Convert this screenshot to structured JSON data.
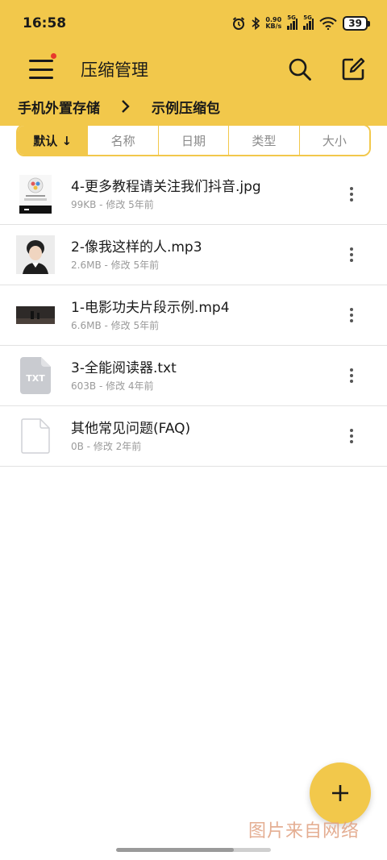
{
  "status_bar": {
    "time": "16:58",
    "net_speed_value": "0.90",
    "net_speed_unit": "KB/s",
    "sim1": "5G",
    "sim2": "5G",
    "battery": "39"
  },
  "app_bar": {
    "title": "压缩管理",
    "menu_icon": "hamburger-menu-icon",
    "search_icon": "search-icon",
    "edit_icon": "edit-icon",
    "notification_dot_color": "#e8382c"
  },
  "breadcrumb": {
    "root": "手机外置存储",
    "current": "示例压缩包"
  },
  "sort_tabs": [
    {
      "label": "默认 ↓",
      "active": true
    },
    {
      "label": "名称",
      "active": false
    },
    {
      "label": "日期",
      "active": false
    },
    {
      "label": "类型",
      "active": false
    },
    {
      "label": "大小",
      "active": false
    }
  ],
  "files": [
    {
      "name": "4-更多教程请关注我们抖音.jpg",
      "meta": "99KB - 修改 5年前",
      "thumb": "image-thumbnail"
    },
    {
      "name": "2-像我这样的人.mp3",
      "meta": "2.6MB - 修改 5年前",
      "thumb": "album-art-thumbnail"
    },
    {
      "name": "1-电影功夫片段示例.mp4",
      "meta": "6.6MB - 修改 5年前",
      "thumb": "video-thumbnail"
    },
    {
      "name": "3-全能阅读器.txt",
      "meta": "603B - 修改 4年前",
      "thumb": "txt-file-icon",
      "thumb_label": "TXT"
    },
    {
      "name": "其他常见问题(FAQ)",
      "meta": "0B - 修改 2年前",
      "thumb": "blank-file-icon"
    }
  ],
  "fab": {
    "icon": "plus-icon"
  },
  "watermark": "图片来自网络",
  "colors": {
    "accent": "#f2c84b",
    "text": "#1a1a1a",
    "meta": "#9a9a9a"
  }
}
